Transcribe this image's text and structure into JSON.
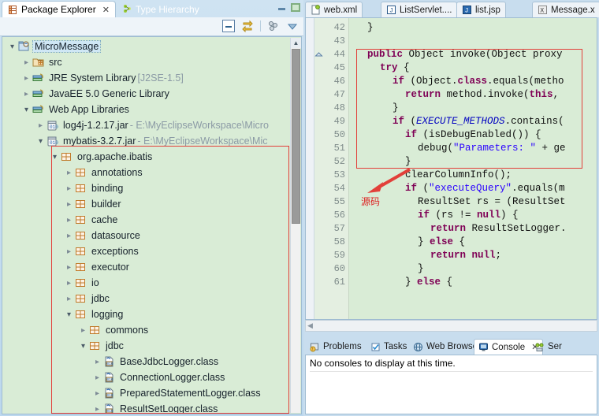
{
  "left_panel": {
    "tabs": [
      {
        "label": "Package Explorer",
        "icon": "package-explorer-icon",
        "active": true,
        "closable": true
      },
      {
        "label": "Type Hierarchy",
        "icon": "type-hierarchy-icon",
        "active": false,
        "closable": false
      }
    ],
    "window_controls": {
      "minimize": "minimize-icon",
      "maximize": "maximize-icon"
    },
    "toolbar_icons": [
      "collapse-all-icon",
      "link-with-editor-icon",
      "view-menu-icon",
      "view-dropdown-icon"
    ],
    "tree": [
      {
        "depth": 0,
        "twist": "open",
        "icon": "java-project-icon",
        "label": "MicroMessage",
        "sub": "",
        "selected": true
      },
      {
        "depth": 1,
        "twist": "closed",
        "icon": "source-folder-icon",
        "label": "src",
        "sub": ""
      },
      {
        "depth": 1,
        "twist": "closed",
        "icon": "library-icon",
        "label": "JRE System Library",
        "sub": "[J2SE-1.5]"
      },
      {
        "depth": 1,
        "twist": "closed",
        "icon": "library-icon",
        "label": "JavaEE 5.0 Generic Library",
        "sub": ""
      },
      {
        "depth": 1,
        "twist": "open",
        "icon": "library-icon",
        "label": "Web App Libraries",
        "sub": ""
      },
      {
        "depth": 2,
        "twist": "closed",
        "icon": "jar-icon",
        "label": "log4j-1.2.17.jar",
        "sub": "- E:\\MyEclipseWorkspace\\Micro"
      },
      {
        "depth": 2,
        "twist": "open",
        "icon": "jar-icon",
        "label": "mybatis-3.2.7.jar",
        "sub": "- E:\\MyEclipseWorkspace\\Mic"
      },
      {
        "depth": 3,
        "twist": "open",
        "icon": "package-icon",
        "label": "org.apache.ibatis",
        "sub": ""
      },
      {
        "depth": 4,
        "twist": "closed",
        "icon": "package-icon",
        "label": "annotations",
        "sub": ""
      },
      {
        "depth": 4,
        "twist": "closed",
        "icon": "package-icon",
        "label": "binding",
        "sub": ""
      },
      {
        "depth": 4,
        "twist": "closed",
        "icon": "package-icon",
        "label": "builder",
        "sub": ""
      },
      {
        "depth": 4,
        "twist": "closed",
        "icon": "package-icon",
        "label": "cache",
        "sub": ""
      },
      {
        "depth": 4,
        "twist": "closed",
        "icon": "package-icon",
        "label": "datasource",
        "sub": ""
      },
      {
        "depth": 4,
        "twist": "closed",
        "icon": "package-icon",
        "label": "exceptions",
        "sub": ""
      },
      {
        "depth": 4,
        "twist": "closed",
        "icon": "package-icon",
        "label": "executor",
        "sub": ""
      },
      {
        "depth": 4,
        "twist": "closed",
        "icon": "package-icon",
        "label": "io",
        "sub": ""
      },
      {
        "depth": 4,
        "twist": "closed",
        "icon": "package-icon",
        "label": "jdbc",
        "sub": ""
      },
      {
        "depth": 4,
        "twist": "open",
        "icon": "package-icon",
        "label": "logging",
        "sub": ""
      },
      {
        "depth": 5,
        "twist": "closed",
        "icon": "package-icon",
        "label": "commons",
        "sub": ""
      },
      {
        "depth": 5,
        "twist": "open",
        "icon": "package-icon",
        "label": "jdbc",
        "sub": ""
      },
      {
        "depth": 6,
        "twist": "closed",
        "icon": "class-file-icon",
        "label": "BaseJdbcLogger.class",
        "sub": ""
      },
      {
        "depth": 6,
        "twist": "closed",
        "icon": "class-file-icon",
        "label": "ConnectionLogger.class",
        "sub": ""
      },
      {
        "depth": 6,
        "twist": "closed",
        "icon": "class-file-icon",
        "label": "PreparedStatementLogger.class",
        "sub": ""
      },
      {
        "depth": 6,
        "twist": "closed",
        "icon": "class-file-icon",
        "label": "ResultSetLogger.class",
        "sub": ""
      }
    ]
  },
  "editor": {
    "tabs": [
      {
        "label": "web.xml",
        "icon": "xml-file-icon",
        "active": false
      },
      {
        "label": "ListServlet....",
        "icon": "java-file-icon",
        "active": false
      },
      {
        "label": "list.jsp",
        "icon": "jsp-file-icon",
        "active": false
      },
      {
        "label": "Message.x",
        "icon": "xml-x-icon",
        "active": false
      }
    ],
    "first_line": 42,
    "lines": [
      {
        "num": 42,
        "indent": 1,
        "segments": [
          {
            "t": "}",
            "c": "plain"
          }
        ]
      },
      {
        "num": 43,
        "indent": 0,
        "segments": []
      },
      {
        "num": 44,
        "indent": 1,
        "fold": "collapse",
        "segments": [
          {
            "t": "public ",
            "c": "kw"
          },
          {
            "t": "Object invoke(Object proxy",
            "c": "plain"
          }
        ]
      },
      {
        "num": 45,
        "indent": 2,
        "segments": [
          {
            "t": "try ",
            "c": "kw"
          },
          {
            "t": "{",
            "c": "plain"
          }
        ]
      },
      {
        "num": 46,
        "indent": 3,
        "segments": [
          {
            "t": "if ",
            "c": "kw"
          },
          {
            "t": "(Object.",
            "c": "plain"
          },
          {
            "t": "class",
            "c": "kw"
          },
          {
            "t": ".equals(metho",
            "c": "plain"
          }
        ]
      },
      {
        "num": 47,
        "indent": 4,
        "segments": [
          {
            "t": "return ",
            "c": "kw"
          },
          {
            "t": "method.invoke(",
            "c": "plain"
          },
          {
            "t": "this",
            "c": "kw"
          },
          {
            "t": ",",
            "c": "plain"
          }
        ]
      },
      {
        "num": 48,
        "indent": 3,
        "segments": [
          {
            "t": "}",
            "c": "plain"
          }
        ]
      },
      {
        "num": 49,
        "indent": 3,
        "segments": [
          {
            "t": "if ",
            "c": "kw"
          },
          {
            "t": "(",
            "c": "plain"
          },
          {
            "t": "EXECUTE_METHODS",
            "c": "fld"
          },
          {
            "t": ".contains(",
            "c": "plain"
          }
        ]
      },
      {
        "num": 50,
        "indent": 4,
        "segments": [
          {
            "t": "if ",
            "c": "kw"
          },
          {
            "t": "(isDebugEnabled()) {",
            "c": "plain"
          }
        ]
      },
      {
        "num": 51,
        "indent": 5,
        "segments": [
          {
            "t": "debug(",
            "c": "plain"
          },
          {
            "t": "\"Parameters: \"",
            "c": "str"
          },
          {
            "t": " + ge",
            "c": "plain"
          }
        ]
      },
      {
        "num": 52,
        "indent": 4,
        "segments": [
          {
            "t": "}",
            "c": "plain"
          }
        ]
      },
      {
        "num": 53,
        "indent": 4,
        "segments": [
          {
            "t": "clearColumnInfo();",
            "c": "plain"
          }
        ]
      },
      {
        "num": 54,
        "indent": 4,
        "segments": [
          {
            "t": "if ",
            "c": "kw"
          },
          {
            "t": "(",
            "c": "plain"
          },
          {
            "t": "\"executeQuery\"",
            "c": "str"
          },
          {
            "t": ".equals(m",
            "c": "plain"
          }
        ]
      },
      {
        "num": 55,
        "indent": 5,
        "segments": [
          {
            "t": "ResultSet rs = (ResultSet",
            "c": "plain"
          }
        ]
      },
      {
        "num": 56,
        "indent": 5,
        "segments": [
          {
            "t": "if ",
            "c": "kw"
          },
          {
            "t": "(rs != ",
            "c": "plain"
          },
          {
            "t": "null",
            "c": "kw"
          },
          {
            "t": ") {",
            "c": "plain"
          }
        ]
      },
      {
        "num": 57,
        "indent": 6,
        "segments": [
          {
            "t": "return ",
            "c": "kw"
          },
          {
            "t": "ResultSetLogger.",
            "c": "plain"
          }
        ]
      },
      {
        "num": 58,
        "indent": 5,
        "segments": [
          {
            "t": "} ",
            "c": "plain"
          },
          {
            "t": "else ",
            "c": "kw"
          },
          {
            "t": "{",
            "c": "plain"
          }
        ]
      },
      {
        "num": 59,
        "indent": 6,
        "segments": [
          {
            "t": "return ",
            "c": "kw"
          },
          {
            "t": "null",
            "c": "kw"
          },
          {
            "t": ";",
            "c": "plain"
          }
        ]
      },
      {
        "num": 60,
        "indent": 5,
        "segments": [
          {
            "t": "}",
            "c": "plain"
          }
        ]
      },
      {
        "num": 61,
        "indent": 4,
        "segments": [
          {
            "t": "} ",
            "c": "plain"
          },
          {
            "t": "else ",
            "c": "kw"
          },
          {
            "t": "{",
            "c": "plain"
          }
        ]
      }
    ],
    "annotation": {
      "text": "源码",
      "color": "#dd2222"
    }
  },
  "bottom_panel": {
    "tabs": [
      {
        "label": "Problems",
        "icon": "problems-icon",
        "active": false,
        "closable": false
      },
      {
        "label": "Tasks",
        "icon": "tasks-icon",
        "active": false,
        "closable": false
      },
      {
        "label": "Web Browser",
        "icon": "web-browser-icon",
        "active": false,
        "closable": false
      },
      {
        "label": "Console",
        "icon": "console-icon",
        "active": true,
        "closable": true
      },
      {
        "label": "Ser",
        "icon": "servers-icon",
        "active": false,
        "closable": false
      }
    ],
    "message": "No consoles to display at this time."
  },
  "colors": {
    "tree_background": "#d9ecd6",
    "editor_background": "#d9ecd6",
    "annotation_red": "#e2403a",
    "keyword_purple": "#7f0055",
    "string_blue": "#2a00ff",
    "field_blue": "#0000c0",
    "chrome_blue": "#bcd8ee"
  }
}
